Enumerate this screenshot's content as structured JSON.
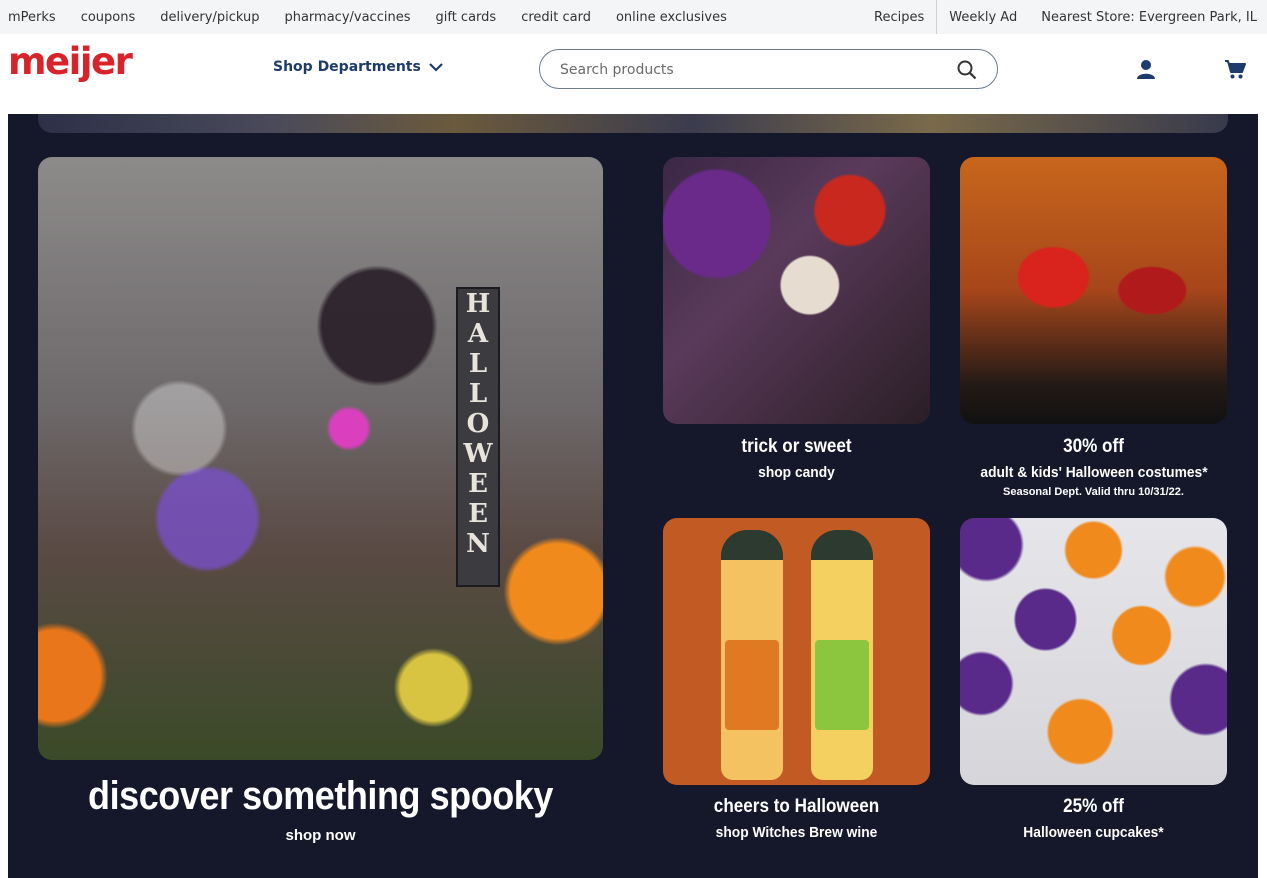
{
  "utility": {
    "left_links": [
      "mPerks",
      "coupons",
      "delivery/pickup",
      "pharmacy/vaccines",
      "gift cards",
      "credit card",
      "online exclusives"
    ],
    "recipes": "Recipes",
    "weekly_ad": "Weekly Ad",
    "nearest_store": "Nearest Store: Evergreen Park, IL"
  },
  "header": {
    "logo": "meijer",
    "shop_departments": "Shop Departments",
    "search_placeholder": "Search products"
  },
  "colors": {
    "brand_red": "#d8232a",
    "navy": "#1d3b6b",
    "panel_bg": "#14182a"
  },
  "tiles": {
    "hero": {
      "title": "discover something spooky",
      "cta": "shop now",
      "sign_text": "HALLOWEEN"
    },
    "candy": {
      "title": "trick or sweet",
      "cta": "shop candy"
    },
    "costumes": {
      "title": "30% off",
      "cta": "adult & kids' Halloween costumes*",
      "fine_print": "Seasonal Dept. Valid thru 10/31/22."
    },
    "wine": {
      "title": "cheers to Halloween",
      "cta": "shop Witches Brew wine"
    },
    "cupcakes": {
      "title": "25% off",
      "cta": "Halloween cupcakes*"
    }
  }
}
